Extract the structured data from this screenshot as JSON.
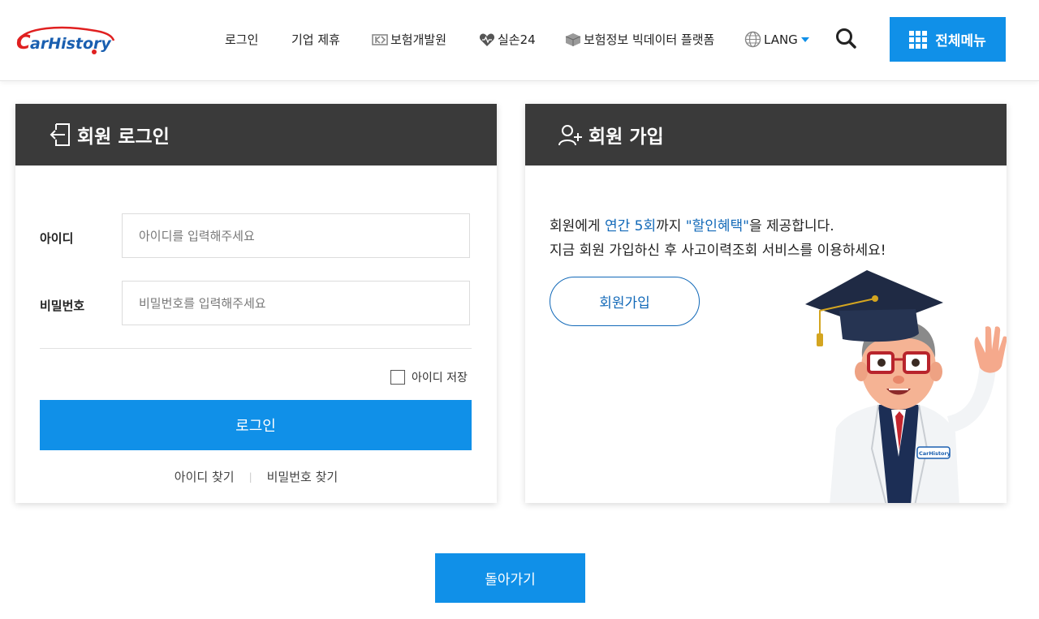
{
  "header": {
    "logo_text": "CarHistory",
    "nav": {
      "login": "로그인",
      "partnership": "기업 제휴",
      "kidi": "보험개발원",
      "silson": "실손24",
      "bigdata": "보험정보 빅데이터 플랫폼",
      "lang": "LANG"
    },
    "menu_label": "전체메뉴"
  },
  "login_panel": {
    "title": "회원 로그인",
    "id_label": "아이디",
    "id_placeholder": "아이디를 입력해주세요",
    "pw_label": "비밀번호",
    "pw_placeholder": "비밀번호를 입력해주세요",
    "remember_label": "아이디 저장",
    "login_button": "로그인",
    "find_id": "아이디 찾기",
    "separator": "|",
    "find_pw": "비밀번호 찾기"
  },
  "signup_panel": {
    "title": "회원 가입",
    "promo_line1_a": "회원에게 ",
    "promo_line1_b": "연간 5회",
    "promo_line1_c": "까지 ",
    "promo_line1_d": "\"할인혜택\"",
    "promo_line1_e": "을 제공합니다.",
    "promo_line2": "지금 회원 가입하신 후 사고이력조회 서비스를 이용하세요!",
    "signup_button": "회원가입",
    "badge_text": "CarHistory"
  },
  "back_button": "돌아가기",
  "colors": {
    "accent": "#1090e8",
    "panel_header": "#3a3a3a",
    "link_blue": "#1269b8",
    "logo_red": "#e02020",
    "logo_blue": "#1a5fb0"
  },
  "icons": [
    "kidi-logo-icon",
    "heart-icon",
    "box-icon",
    "globe-icon",
    "search-icon",
    "grid-icon",
    "login-arrow-icon",
    "add-user-icon",
    "mascot-illustration"
  ]
}
